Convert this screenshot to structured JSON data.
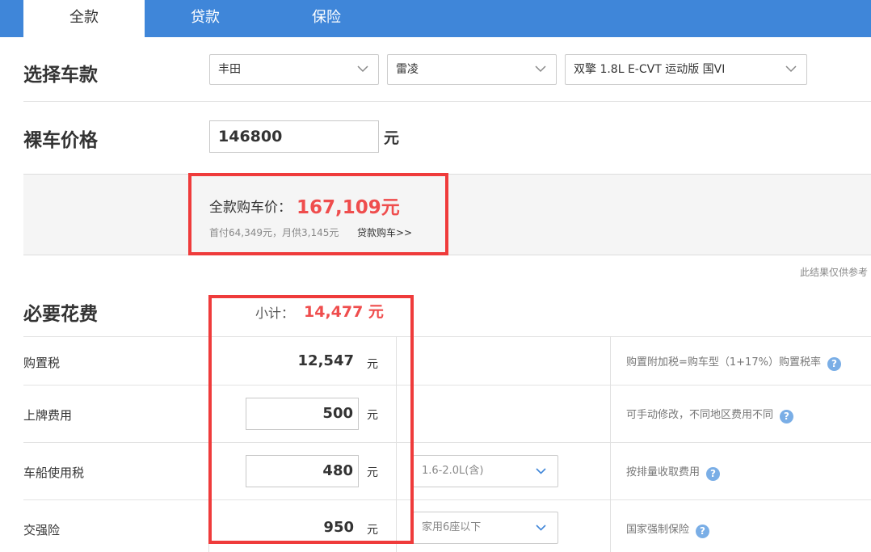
{
  "tabs": [
    {
      "label": "全款",
      "active": true
    },
    {
      "label": "贷款",
      "active": false
    },
    {
      "label": "保险",
      "active": false
    }
  ],
  "select_car": {
    "title": "选择车款",
    "brand": "丰田",
    "series": "雷凌",
    "model": "双擎 1.8L E-CVT 运动版 国VI"
  },
  "bare_price": {
    "title": "裸车价格",
    "value": "146800",
    "unit": "元"
  },
  "summary": {
    "total_label": "全款购车价：",
    "total_value": "167,109元",
    "sub_text": "首付64,349元，月供3,145元",
    "loan_link": "贷款购车>>"
  },
  "disclaimer": "此结果仅供参考",
  "required": {
    "title": "必要花费",
    "subtotal_label": "小计：",
    "subtotal_value": "14,477 元",
    "items": [
      {
        "label": "购置税",
        "value": "12,547",
        "unit": "元",
        "hint": "购置附加税=购车型（1+17%）购置税率"
      },
      {
        "label": "上牌费用",
        "value": "500",
        "unit": "元",
        "hint": "可手动修改，不同地区费用不同"
      },
      {
        "label": "车船使用税",
        "value": "480",
        "unit": "元",
        "select": "1.6-2.0L(含)",
        "hint": "按排量收取费用"
      },
      {
        "label": "交强险",
        "value": "950",
        "unit": "元",
        "select": "家用6座以下",
        "hint": "国家强制保险"
      }
    ]
  },
  "colors": {
    "tab_bar": "#3f86d9",
    "accent_red": "#ef4d4d",
    "highlight_border": "#ef3b3b",
    "help_icon": "#7aaee6"
  }
}
